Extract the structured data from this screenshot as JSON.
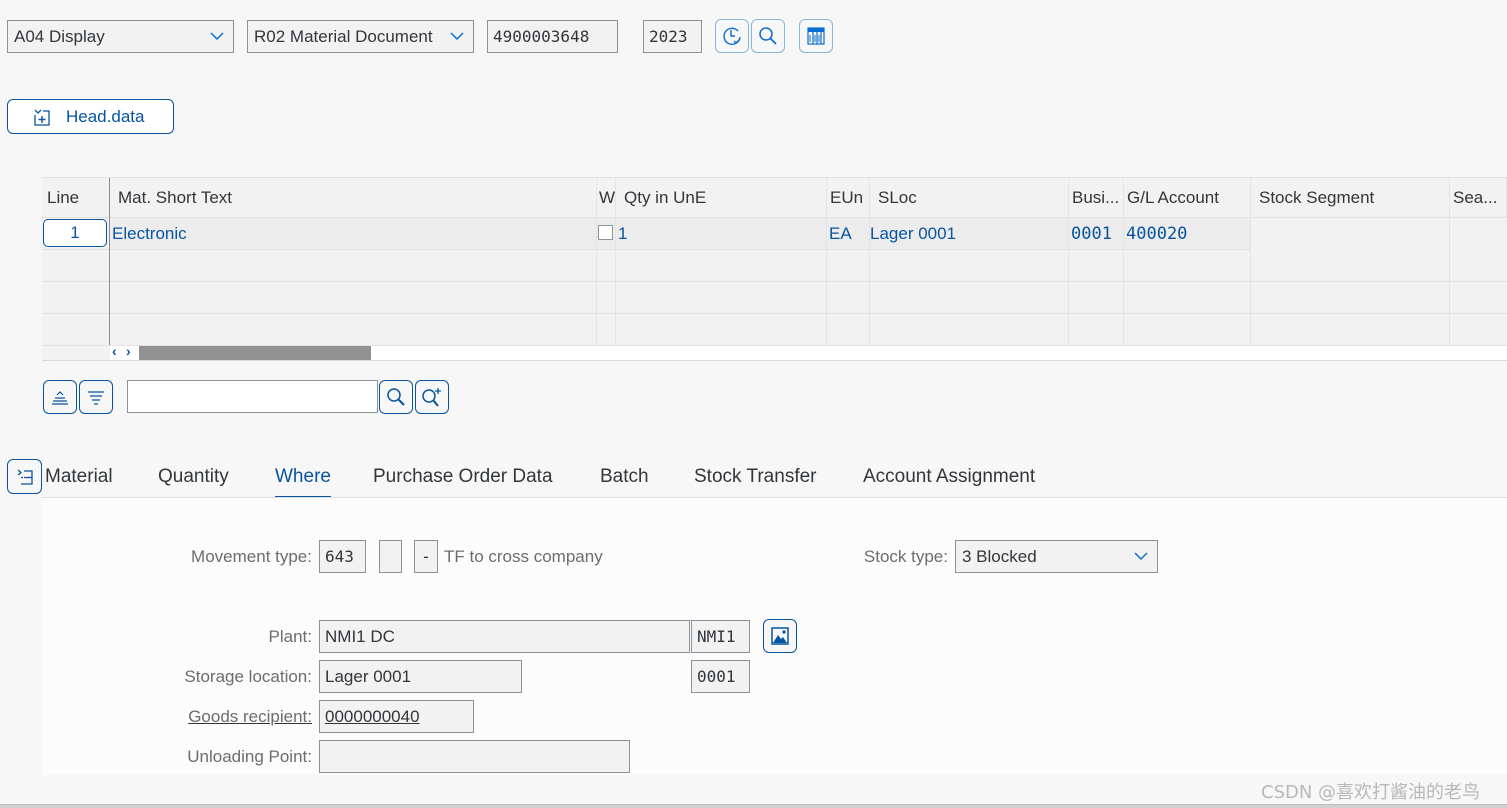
{
  "toolbar": {
    "action_select": "A04 Display",
    "reference_select": "R02 Material Document",
    "document_number": "4900003648",
    "year": "2023",
    "buttons": [
      {
        "icon": "history-icon"
      },
      {
        "icon": "search-icon"
      },
      {
        "icon": "columns-icon"
      }
    ]
  },
  "head_data_button": {
    "label": "Head.data",
    "icon": "expand-header-icon"
  },
  "items_table": {
    "columns": [
      "Line",
      "Mat. Short Text",
      "W",
      "Qty in UnE",
      "EUn",
      "SLoc",
      "Busi...",
      "G/L Account",
      "Stock Segment",
      "Sea..."
    ],
    "rows": [
      {
        "line": "1",
        "mat_short_text": "Electronic",
        "w_checked": false,
        "qty": "1",
        "eun": "EA",
        "sloc": "Lager 0001",
        "business_area": "0001",
        "gl_account": "400020",
        "stock_segment": "",
        "season": ""
      }
    ],
    "empty_rows": 3,
    "scroll_left": "‹",
    "scroll_right": "›"
  },
  "table_tools": {
    "search_placeholder": "",
    "search_value": ""
  },
  "tabs": {
    "items": [
      "Material",
      "Quantity",
      "Where",
      "Purchase Order Data",
      "Batch",
      "Stock Transfer",
      "Account Assignment"
    ],
    "active": "Where"
  },
  "where_tab": {
    "movement_type_label": "Movement type:",
    "movement_type": "643",
    "movement_indicator": "",
    "movement_sign": "-",
    "movement_desc": "TF to cross company",
    "stock_type_label": "Stock type:",
    "stock_type": "3 Blocked",
    "plant_label": "Plant:",
    "plant_name": "NMI1 DC",
    "plant_code": "NMI1",
    "storage_location_label": "Storage location:",
    "storage_location_name": "Lager 0001",
    "storage_location_code": "0001",
    "goods_recipient_label": "Goods recipient:",
    "goods_recipient": "0000000040",
    "unloading_point_label": "Unloading Point:",
    "unloading_point": ""
  },
  "watermark": "CSDN @喜欢打酱油的老鸟"
}
